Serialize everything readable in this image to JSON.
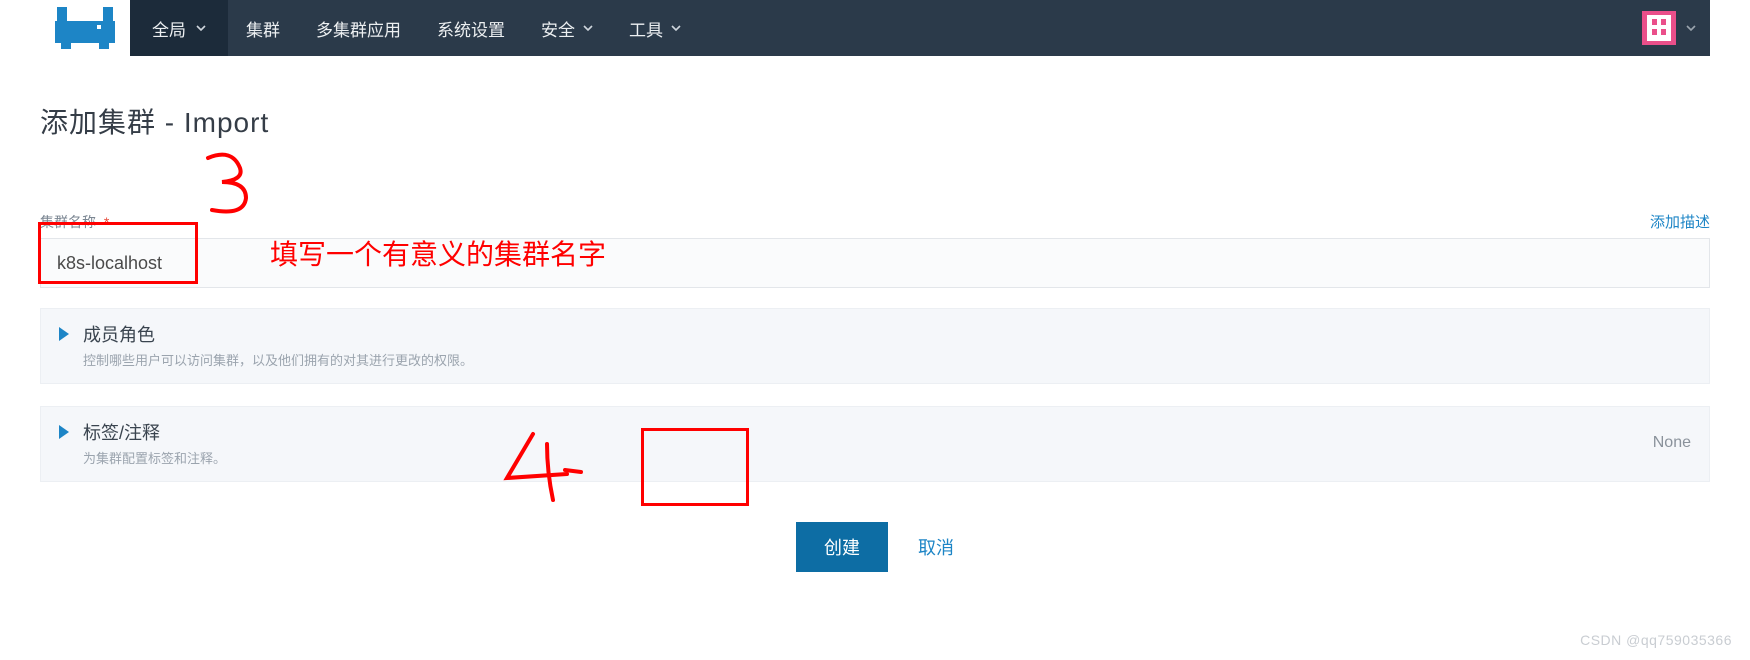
{
  "nav": {
    "scope_label": "全局",
    "items": [
      {
        "label": "集群",
        "has_caret": false
      },
      {
        "label": "多集群应用",
        "has_caret": false
      },
      {
        "label": "系统设置",
        "has_caret": false
      },
      {
        "label": "安全",
        "has_caret": true
      },
      {
        "label": "工具",
        "has_caret": true
      }
    ]
  },
  "page": {
    "title": "添加集群 - Import"
  },
  "form": {
    "cluster_name_label": "集群名称",
    "cluster_name_value": "k8s-localhost",
    "add_description_link": "添加描述"
  },
  "panels": {
    "members": {
      "title": "成员角色",
      "subtitle": "控制哪些用户可以访问集群，以及他们拥有的对其进行更改的权限。"
    },
    "labels": {
      "title": "标签/注释",
      "subtitle": "为集群配置标签和注释。",
      "right": "None"
    }
  },
  "actions": {
    "create": "创建",
    "cancel": "取消"
  },
  "annotations": {
    "step3": "3",
    "step4": "4",
    "hint": "填写一个有意义的集群名字"
  },
  "watermark": "CSDN @qq759035366"
}
